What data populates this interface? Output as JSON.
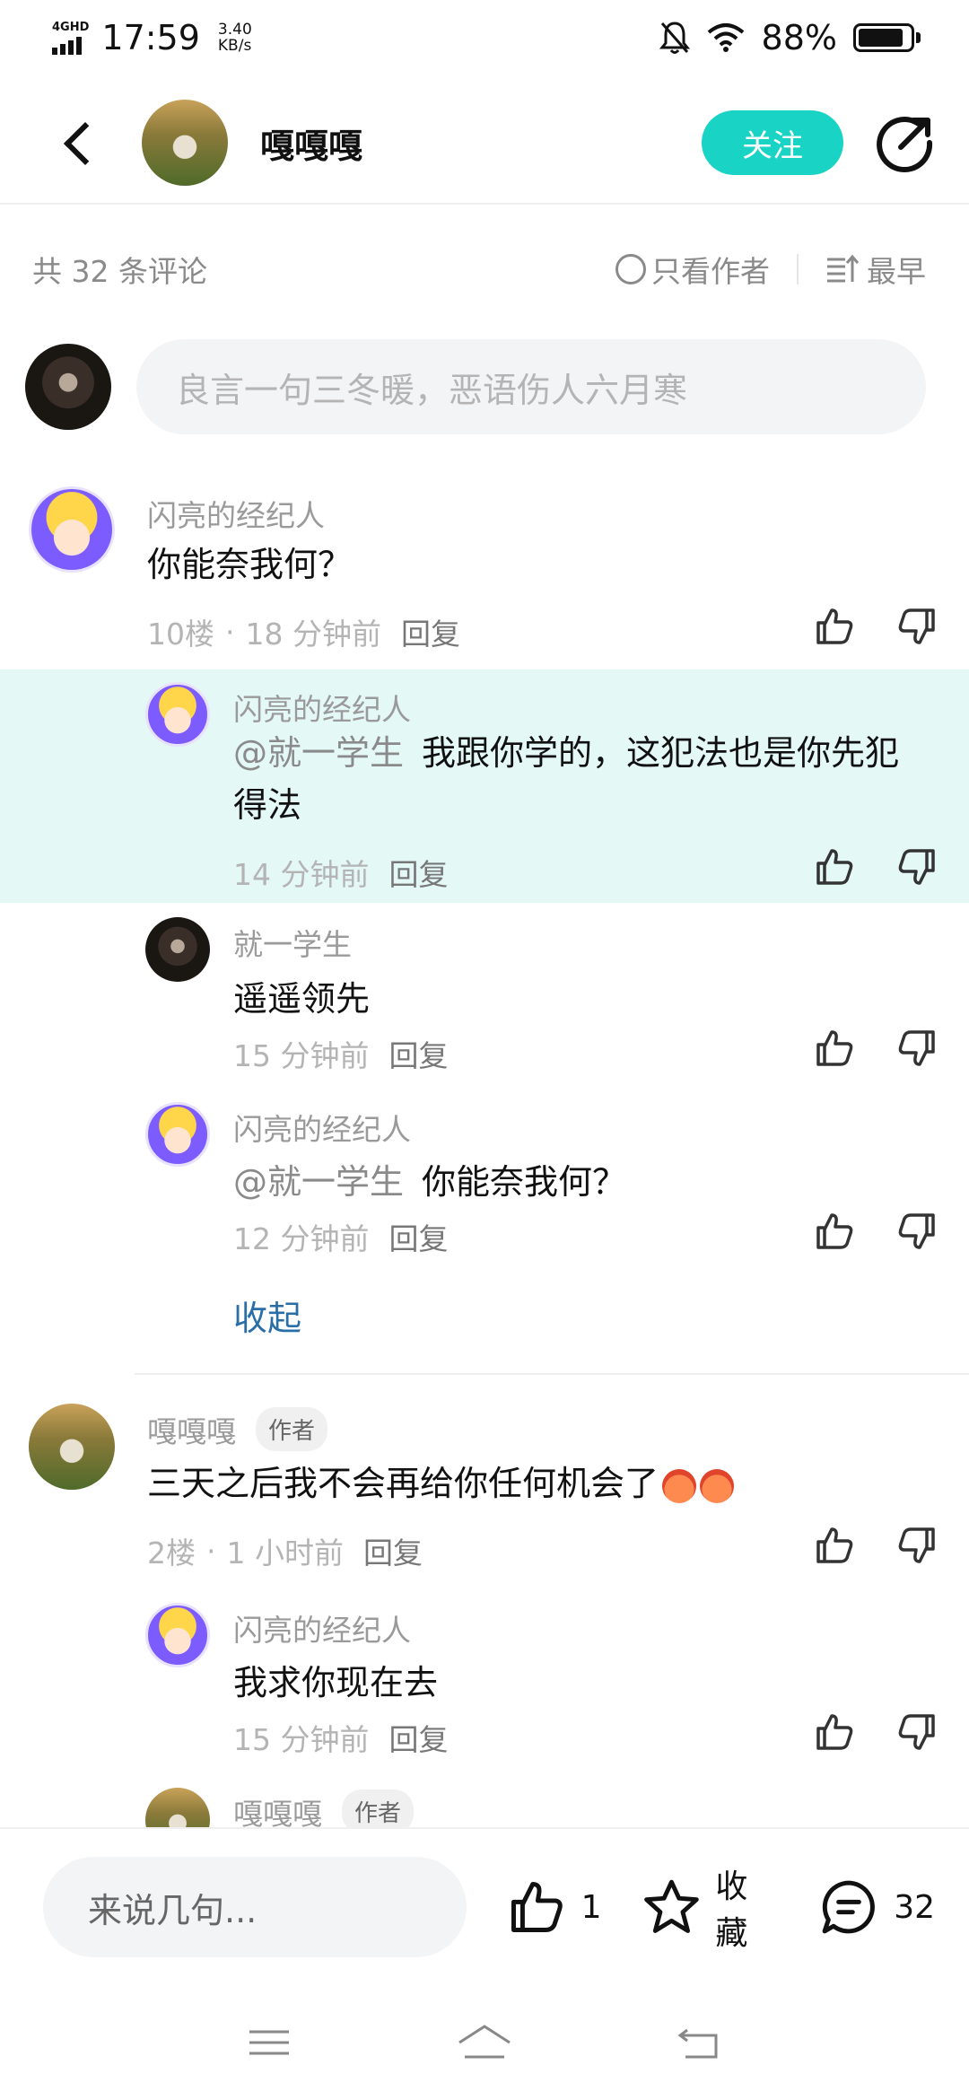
{
  "status": {
    "network": "4GHD",
    "time": "17:59",
    "speed_value": "3.40",
    "speed_unit": "KB/s",
    "battery": "88%",
    "battery_level": 0.88
  },
  "header": {
    "title": "嘎嘎嘎",
    "follow_label": "关注"
  },
  "filter": {
    "count_label": "共 32 条评论",
    "author_only_label": "只看作者",
    "sort_label": "最早"
  },
  "composer": {
    "placeholder": "良言一句三冬暖，恶语伤人六月寒"
  },
  "comments": [
    {
      "name": "闪亮的经纪人",
      "text": "你能奈我何？",
      "floor": "10楼",
      "time": "18 分钟前",
      "reply": "回复"
    },
    {
      "name": "闪亮的经纪人",
      "mention": "@就一学生",
      "text": "我跟你学的，这犯法也是你先犯得法",
      "time": "14 分钟前",
      "reply": "回复"
    },
    {
      "name": "就一学生",
      "text": "遥遥领先",
      "time": "15 分钟前",
      "reply": "回复"
    },
    {
      "name": "闪亮的经纪人",
      "mention": "@就一学生",
      "text": "你能奈我何？",
      "time": "12 分钟前",
      "reply": "回复"
    },
    {
      "name": "嘎嘎嘎",
      "tag": "作者",
      "text": "三天之后我不会再给你任何机会了",
      "floor": "2楼",
      "time": "1 小时前",
      "reply": "回复"
    },
    {
      "name": "闪亮的经纪人",
      "text": "我求你现在去",
      "time": "15 分钟前",
      "reply": "回复"
    },
    {
      "name": "嘎嘎嘎",
      "tag": "作者"
    }
  ],
  "collapse_label": "收起",
  "bottom": {
    "input_placeholder": "来说几句...",
    "like_count": "1",
    "favorite_label": "收藏",
    "comment_count": "32"
  },
  "icons": [
    "back-icon",
    "share-icon",
    "sort-icon",
    "thumb-up-icon",
    "thumb-down-icon",
    "star-icon",
    "comment-bubble-icon",
    "menu-icon",
    "home-icon",
    "return-icon"
  ],
  "colors": {
    "accent": "#19d3c5",
    "highlight": "#e4f8f6",
    "link": "#2a6ea8"
  }
}
